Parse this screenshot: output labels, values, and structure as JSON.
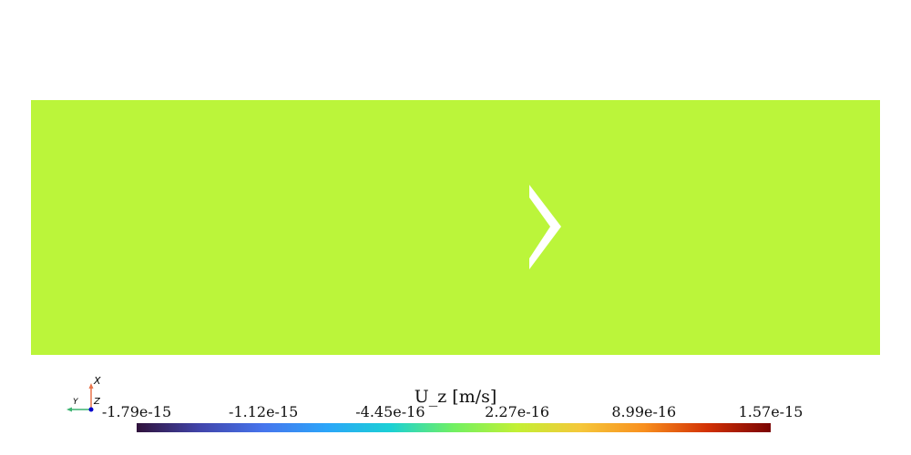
{
  "colorbar": {
    "title": "U_z [m/s]",
    "ticks": [
      "-1.79e-15",
      "-1.12e-15",
      "-4.45e-16",
      "2.27e-16",
      "8.99e-16",
      "1.57e-15"
    ],
    "min": -1.79e-15,
    "max": 1.57e-15,
    "colormap": "turbo"
  },
  "axes_triad": {
    "x_label": "X",
    "y_label": "Y",
    "z_label": "Z",
    "x_color": "#e8734a",
    "y_color": "#3cb371",
    "z_color": "#0000cc"
  },
  "field": {
    "fill_color": "#bbf53a"
  }
}
